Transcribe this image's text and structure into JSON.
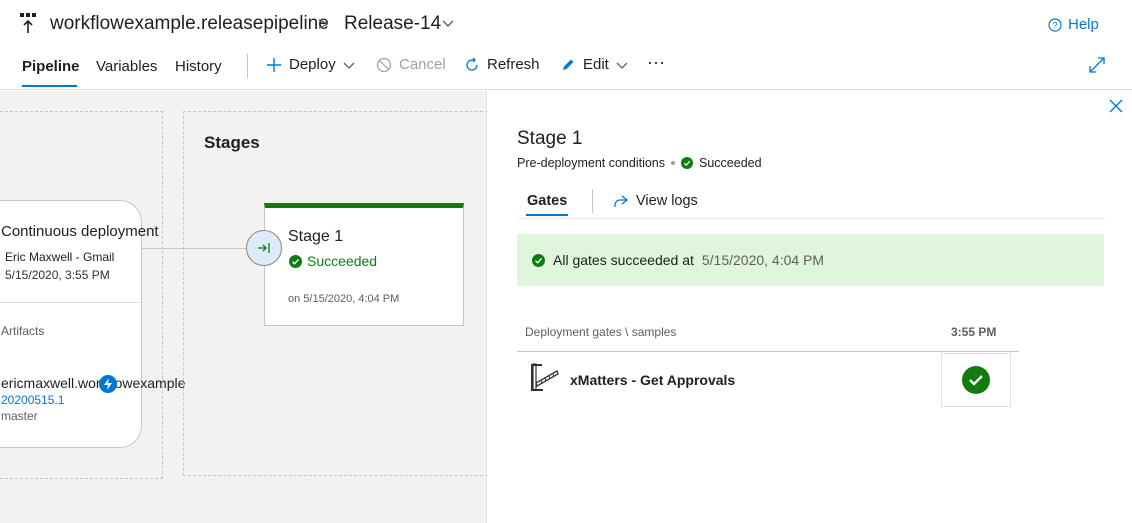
{
  "header": {
    "pipeline_name": "workflowexample.releasepipeline",
    "breadcrumb_sep": ">",
    "release_name": "Release-14",
    "help_label": "Help"
  },
  "toolbar": {
    "tabs": [
      {
        "label": "Pipeline",
        "active": true
      },
      {
        "label": "Variables",
        "active": false
      },
      {
        "label": "History",
        "active": false
      }
    ],
    "deploy_label": "Deploy",
    "cancel_label": "Cancel",
    "refresh_label": "Refresh",
    "edit_label": "Edit",
    "more_label": "···"
  },
  "canvas": {
    "trigger": {
      "name": "Continuous deployment",
      "by": "Eric Maxwell - Gmail",
      "date": "5/15/2020, 3:55 PM",
      "artifacts_label": "Artifacts",
      "artifact_name": "ericmaxwell.workflowexample",
      "version": "20200515.1",
      "branch": "master"
    },
    "stages_label": "Stages",
    "stage": {
      "name": "Stage 1",
      "status": "Succeeded",
      "time": "on 5/15/2020, 4:04 PM"
    }
  },
  "panel": {
    "title": "Stage 1",
    "subtitle": "Pre-deployment conditions",
    "status": "Succeeded",
    "tabs": {
      "gates": "Gates",
      "logs": "View logs"
    },
    "banner": {
      "text": "All gates succeeded at",
      "time": "5/15/2020, 4:04 PM"
    },
    "gates_header": "Deployment gates \\ samples",
    "gates_time": "3:55 PM",
    "gate_name": "xMatters - Get Approvals"
  },
  "colors": {
    "accent": "#0078d4",
    "success": "#107c10",
    "success_bg": "#dff6dd"
  }
}
